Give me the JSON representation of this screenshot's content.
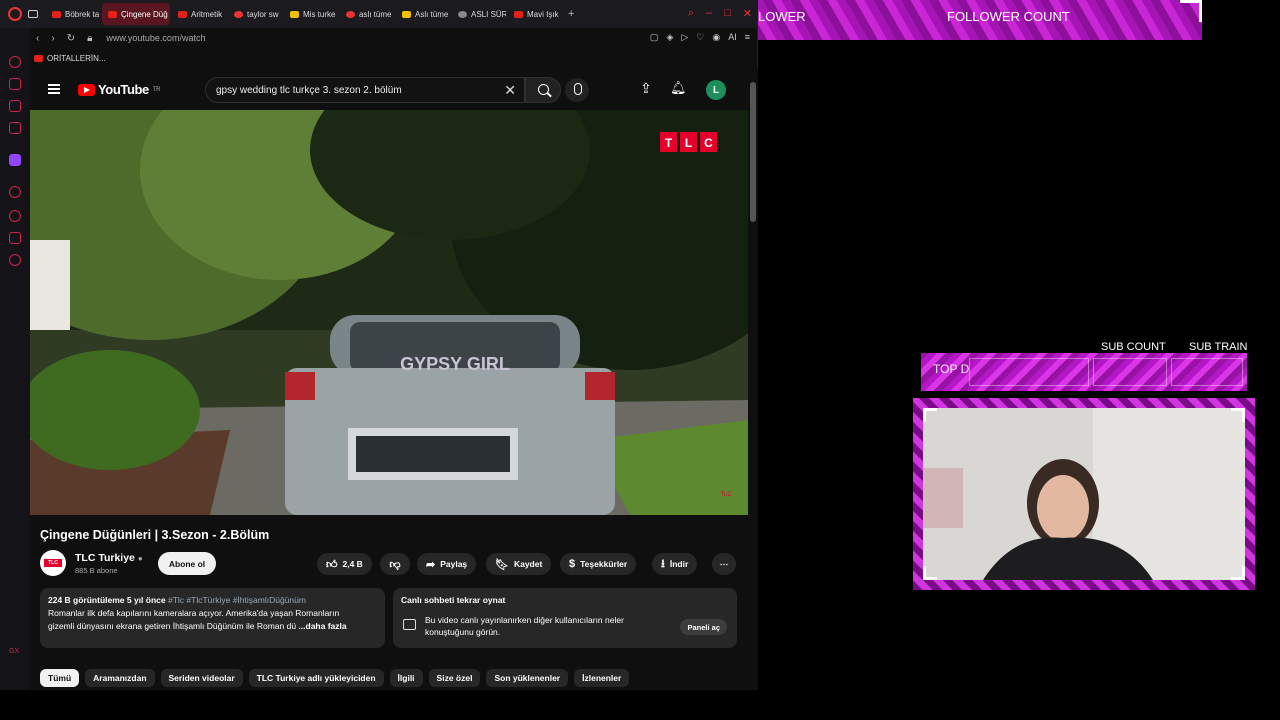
{
  "browser": {
    "tabs": [
      {
        "label": "Böbrek ta",
        "fav": "yt",
        "active": false
      },
      {
        "label": "Çingene Düğ",
        "fav": "yt",
        "active": true
      },
      {
        "label": "Aritmetik",
        "fav": "yt",
        "active": false
      },
      {
        "label": "taylor sw",
        "fav": "o",
        "active": false
      },
      {
        "label": "Mis turke",
        "fav": "y",
        "active": false
      },
      {
        "label": "aslı tüme",
        "fav": "o",
        "active": false
      },
      {
        "label": "Aslı tüme",
        "fav": "y",
        "active": false
      },
      {
        "label": "ASLI SÜR",
        "fav": "g",
        "active": false
      },
      {
        "label": "Mavi Işık",
        "fav": "yt",
        "active": false
      }
    ],
    "url": "www.youtube.com/watch",
    "toolbar_ai": "AI",
    "bookmark": "ORİTALLERİN..."
  },
  "youtube": {
    "logo_text": "YouTube",
    "region": "TR",
    "search_query": "gpsy wedding tlc turkçe 3. sezon 2. bölüm",
    "avatar_letter": "L",
    "video_watermark": [
      "T",
      "L",
      "C"
    ],
    "plate_text": "GYPSY GIRL",
    "small_tlc": "TLC",
    "video_title": "Çingene Düğünleri | 3.Sezon - 2.Bölüm",
    "channel": {
      "name": "TLC Turkiye",
      "subs": "885 B abone",
      "logo_text": "TLC",
      "subscribe": "Abone ol"
    },
    "actions": {
      "likes": "2,4 B",
      "share": "Paylaş",
      "save": "Kaydet",
      "thanks": "Teşekkürler",
      "download": "İndir"
    },
    "description": {
      "meta": "224 B görüntüleme  5 yıl önce",
      "tags": "#Tlc #TlcTürkiye #İhtişamlıDüğünüm",
      "line1": "Romanlar ilk defa kapılarını kameralara açıyor. Amerika'da yaşan Romanların",
      "line2": "gizemli dünyasını ekrana getiren İhtişamlı Düğünüm ile Roman dü",
      "more": "...daha fazla"
    },
    "chat": {
      "title": "Canlı sohbeti tekrar oynat",
      "desc": "Bu video canlı yayınlanırken diğer kullanıcıların neler konuştuğunu görün.",
      "button": "Paneli aç"
    },
    "chips": [
      {
        "label": "Tümü",
        "active": true
      },
      {
        "label": "Aramanızdan",
        "active": false
      },
      {
        "label": "Seriden videolar",
        "active": false
      },
      {
        "label": "TLC Turkiye adlı yükleyiciden",
        "active": false
      },
      {
        "label": "İlgili",
        "active": false
      },
      {
        "label": "Size özel",
        "active": false
      },
      {
        "label": "Son yüklenenler",
        "active": false
      },
      {
        "label": "İzlenenler",
        "active": false
      }
    ]
  },
  "overlay": {
    "follower_left": "LOWER",
    "follower_count": "FOLLOWER COUNT",
    "sub_count": "SUB COUNT",
    "sub_train": "SUB TRAIN",
    "top_donor": "TOP D",
    "accent": "#c020d0"
  }
}
